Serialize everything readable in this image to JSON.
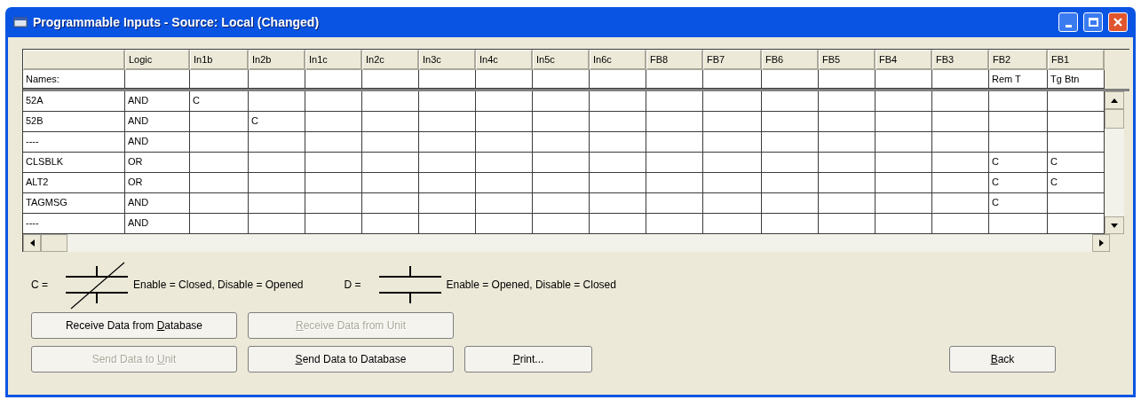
{
  "window": {
    "title": "Programmable Inputs - Source: Local (Changed)"
  },
  "grid": {
    "columns": [
      "Logic",
      "In1b",
      "In2b",
      "In1c",
      "In2c",
      "In3c",
      "In4c",
      "In5c",
      "In6c",
      "FB8",
      "FB7",
      "FB6",
      "FB5",
      "FB4",
      "FB3",
      "FB2",
      "FB1"
    ],
    "names_row": {
      "label": "Names:",
      "cells": [
        null,
        null,
        null,
        null,
        null,
        null,
        null,
        null,
        null,
        null,
        null,
        null,
        null,
        null,
        null,
        "Rem T",
        "Tg Btn"
      ]
    },
    "rows": [
      {
        "name": "52A",
        "cells": [
          "AND",
          "C",
          null,
          null,
          null,
          null,
          null,
          null,
          null,
          null,
          null,
          null,
          null,
          null,
          null,
          null,
          null
        ]
      },
      {
        "name": "52B",
        "cells": [
          "AND",
          null,
          "C",
          null,
          null,
          null,
          null,
          null,
          null,
          null,
          null,
          null,
          null,
          null,
          null,
          null,
          null
        ]
      },
      {
        "name": "----",
        "cells": [
          "AND",
          null,
          null,
          null,
          null,
          null,
          null,
          null,
          null,
          null,
          null,
          null,
          null,
          null,
          null,
          null,
          null
        ]
      },
      {
        "name": "CLSBLK",
        "cells": [
          "OR",
          null,
          null,
          null,
          null,
          null,
          null,
          null,
          null,
          null,
          null,
          null,
          null,
          null,
          null,
          "C",
          "C"
        ]
      },
      {
        "name": "ALT2",
        "cells": [
          "OR",
          null,
          null,
          null,
          null,
          null,
          null,
          null,
          null,
          null,
          null,
          null,
          null,
          null,
          null,
          "C",
          "C"
        ]
      },
      {
        "name": "TAGMSG",
        "cells": [
          "AND",
          null,
          null,
          null,
          null,
          null,
          null,
          null,
          null,
          null,
          null,
          null,
          null,
          null,
          null,
          "C",
          null
        ]
      },
      {
        "name": "----",
        "cells": [
          "AND",
          null,
          null,
          null,
          null,
          null,
          null,
          null,
          null,
          null,
          null,
          null,
          null,
          null,
          null,
          null,
          null
        ]
      }
    ]
  },
  "legend": [
    {
      "kind": "closed",
      "symbol": "C =",
      "text": "Enable = Closed, Disable = Opened"
    },
    {
      "kind": "open",
      "symbol": "D =",
      "text": "Enable = Opened, Disable = Closed"
    }
  ],
  "button_rows": [
    [
      {
        "before": "Receive Data from ",
        "key": "D",
        "after": "atabase",
        "disabled": false
      },
      {
        "key": "R",
        "after": "eceive Data from Unit",
        "disabled": true
      }
    ],
    [
      {
        "before": "Send Data to ",
        "key": "U",
        "after": "nit",
        "disabled": true
      },
      {
        "key": "S",
        "after": "end Data to Database",
        "disabled": false
      },
      {
        "key": "P",
        "after": "rint...",
        "disabled": false
      },
      {
        "key": "B",
        "after": "ack",
        "disabled": false
      }
    ]
  ]
}
